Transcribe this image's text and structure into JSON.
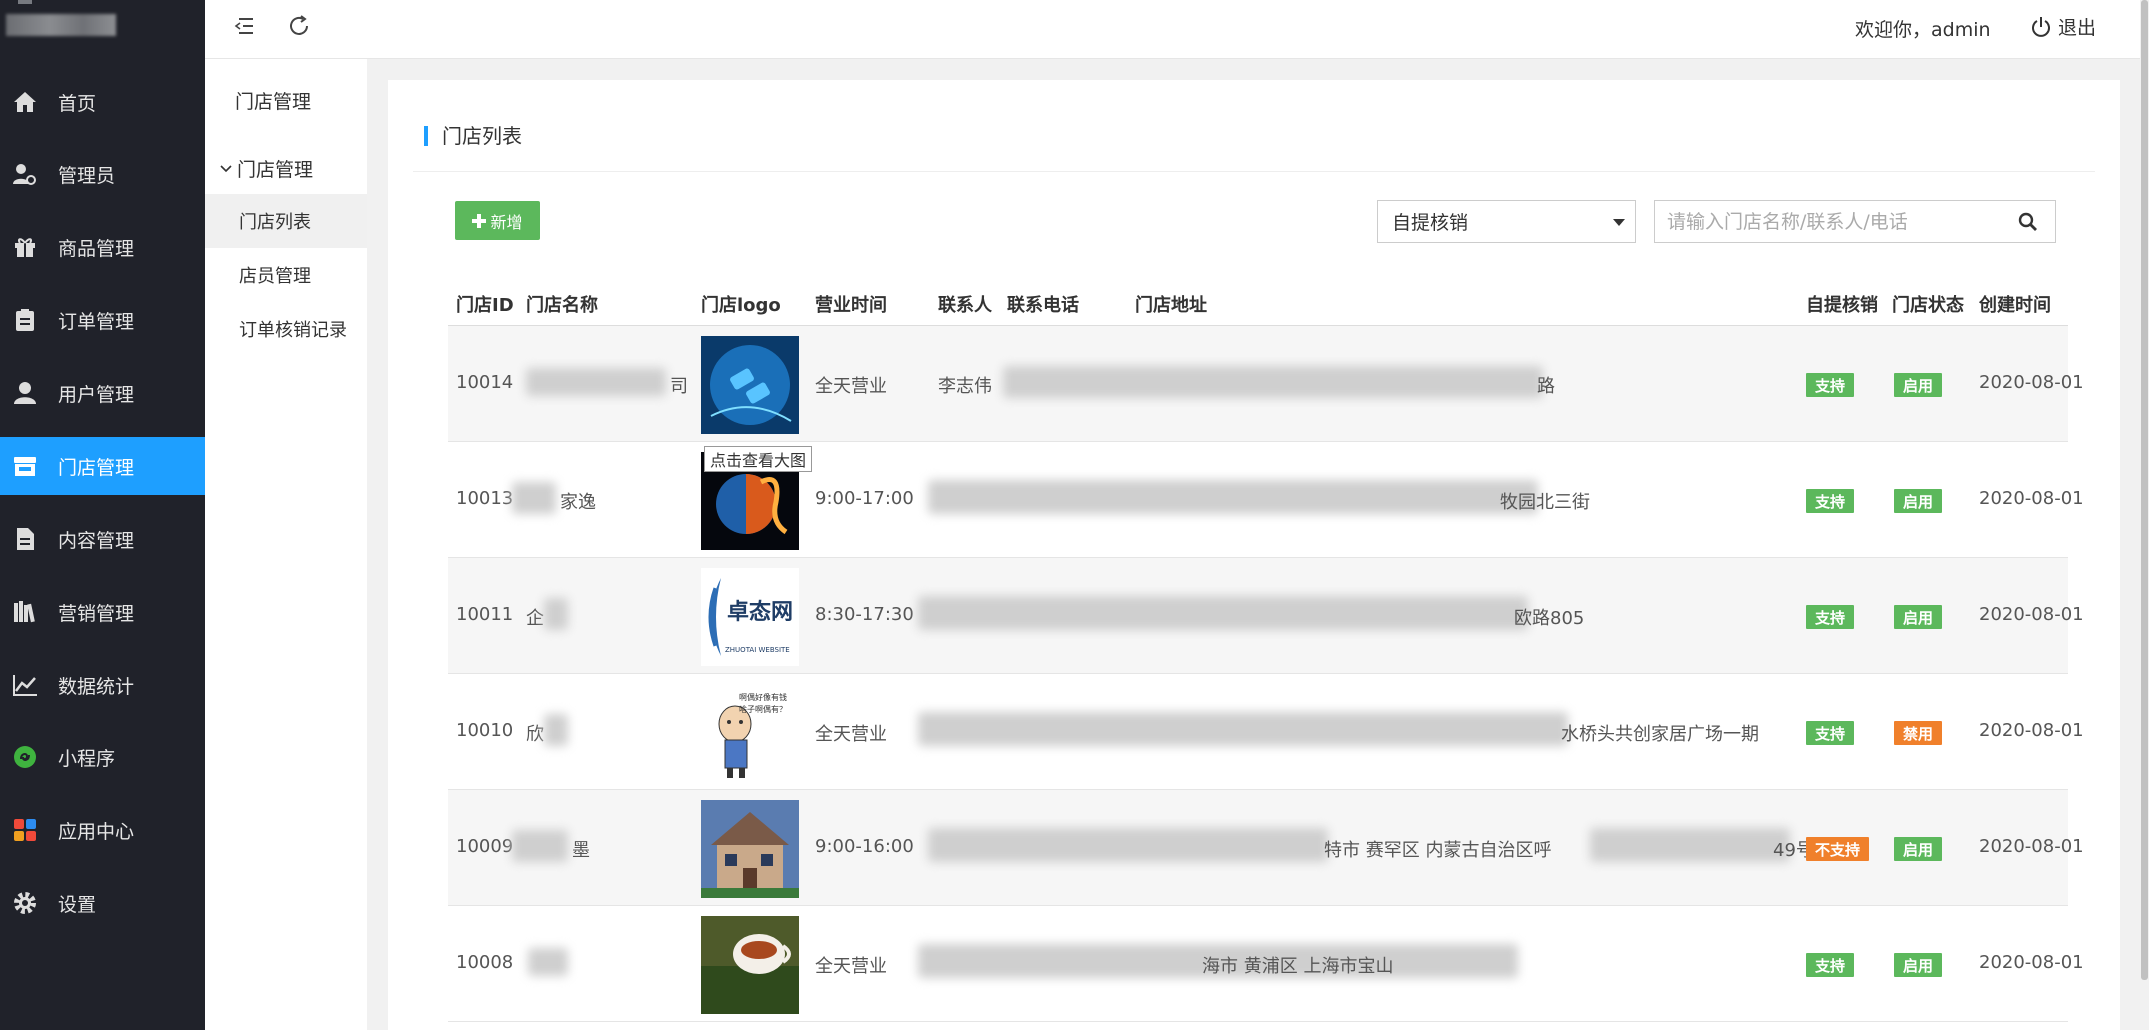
{
  "sidebar": {
    "items": [
      {
        "label": "首页",
        "icon": "home-icon"
      },
      {
        "label": "管理员",
        "icon": "admin-user-icon"
      },
      {
        "label": "商品管理",
        "icon": "gift-icon"
      },
      {
        "label": "订单管理",
        "icon": "clipboard-icon"
      },
      {
        "label": "用户管理",
        "icon": "user-icon"
      },
      {
        "label": "门店管理",
        "icon": "store-icon"
      },
      {
        "label": "内容管理",
        "icon": "document-icon"
      },
      {
        "label": "营销管理",
        "icon": "books-icon"
      },
      {
        "label": "数据统计",
        "icon": "line-chart-icon"
      },
      {
        "label": "小程序",
        "icon": "miniprogram-icon"
      },
      {
        "label": "应用中心",
        "icon": "apps-icon"
      },
      {
        "label": "设置",
        "icon": "gear-icon"
      }
    ],
    "active": "门店管理"
  },
  "topbar": {
    "welcome": "欢迎你，admin",
    "logout": "退出"
  },
  "subnav": {
    "title": "门店管理",
    "group": "门店管理",
    "items": [
      "门店列表",
      "店员管理",
      "订单核销记录"
    ],
    "active": "门店列表"
  },
  "main": {
    "title": "门店列表",
    "add_button": "新增",
    "filter_selected": "自提核销",
    "search_placeholder": "请输入门店名称/联系人/电话"
  },
  "table": {
    "headers": [
      "门店ID",
      "门店名称",
      "门店logo",
      "营业时间",
      "联系人",
      "联系电话",
      "门店地址",
      "自提核销",
      "门店状态",
      "创建时间"
    ],
    "rows": [
      {
        "id": "10014",
        "name": "司",
        "hours": "全天营业",
        "contact": "李志伟",
        "address": "路",
        "pickup": "支持",
        "status": "启用",
        "created": "2020-08-01"
      },
      {
        "id": "10013",
        "name": "家逸",
        "hours": "9:00-17:00",
        "contact": "",
        "address": "牧园北三街",
        "pickup": "支持",
        "status": "启用",
        "created": "2020-08-01"
      },
      {
        "id": "10011",
        "name": "企",
        "hours": "8:30-17:30",
        "contact": "",
        "address": "欧路805",
        "pickup": "支持",
        "status": "启用",
        "created": "2020-08-01"
      },
      {
        "id": "10010",
        "name": "欣",
        "hours": "全天营业",
        "contact": "",
        "address": "水桥头共创家居广场一期",
        "pickup": "支持",
        "status": "禁用",
        "created": "2020-08-01"
      },
      {
        "id": "10009",
        "name": "墨",
        "hours": "9:00-16:00",
        "contact": "",
        "address": "特市 赛罕区 内蒙古自治区呼",
        "address2": "49号",
        "pickup": "不支持",
        "status": "启用",
        "created": "2020-08-01"
      },
      {
        "id": "10008",
        "name": "",
        "hours": "全天营业",
        "contact": "",
        "address": "海市 黄浦区 上海市宝山",
        "pickup": "支持",
        "status": "启用",
        "created": "2020-08-01"
      }
    ],
    "logo_texts": {
      "zhuotai": "卓态网",
      "zhuotai_sub": "ZHUOTAI WEBSITE",
      "cartoon": "啊偶好像有钱 啥子啊偶有？"
    },
    "tooltip": "点击查看大图"
  },
  "colors": {
    "sidebar": "#20222a",
    "accent": "#1e9fff",
    "green": "#5cb85c",
    "orange": "#f0802b"
  }
}
